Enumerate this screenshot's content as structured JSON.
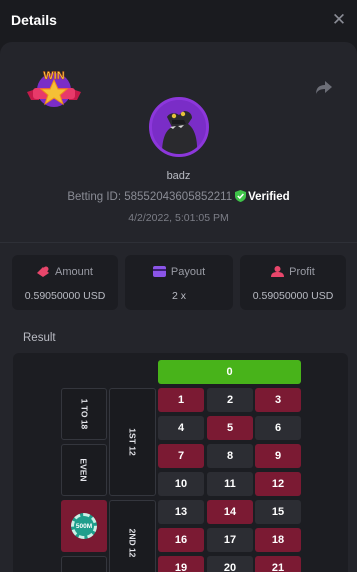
{
  "header": {
    "title": "Details",
    "close_glyph": "✕"
  },
  "badge": {
    "text": "WIN"
  },
  "user": {
    "name": "badz"
  },
  "bet": {
    "id_label": "Betting ID:",
    "id_value": "58552043605852211",
    "verified_label": "Verified",
    "date": "4/2/2022, 5:01:05 PM"
  },
  "stats": {
    "amount": {
      "label": "Amount",
      "value": "0.59050000 USD"
    },
    "payout": {
      "label": "Payout",
      "value": "2 x"
    },
    "profit": {
      "label": "Profit",
      "value": "0.59050000 USD"
    }
  },
  "result": {
    "label": "Result",
    "zero": "0",
    "low": "1 TO 18",
    "even": "EVEN",
    "dozen1": "1ST 12",
    "dozen2": "2ND 12",
    "chip": "500M",
    "numbers": [
      [
        "1",
        "2",
        "3"
      ],
      [
        "4",
        "5",
        "6"
      ],
      [
        "7",
        "8",
        "9"
      ],
      [
        "10",
        "11",
        "12"
      ],
      [
        "13",
        "14",
        "15"
      ],
      [
        "16",
        "17",
        "18"
      ],
      [
        "19",
        "20",
        "21"
      ]
    ]
  },
  "colors": {
    "accent_green": "#48b31a",
    "roulette_red": "#7b1a33",
    "avatar_purple": "#7a2dc7"
  }
}
